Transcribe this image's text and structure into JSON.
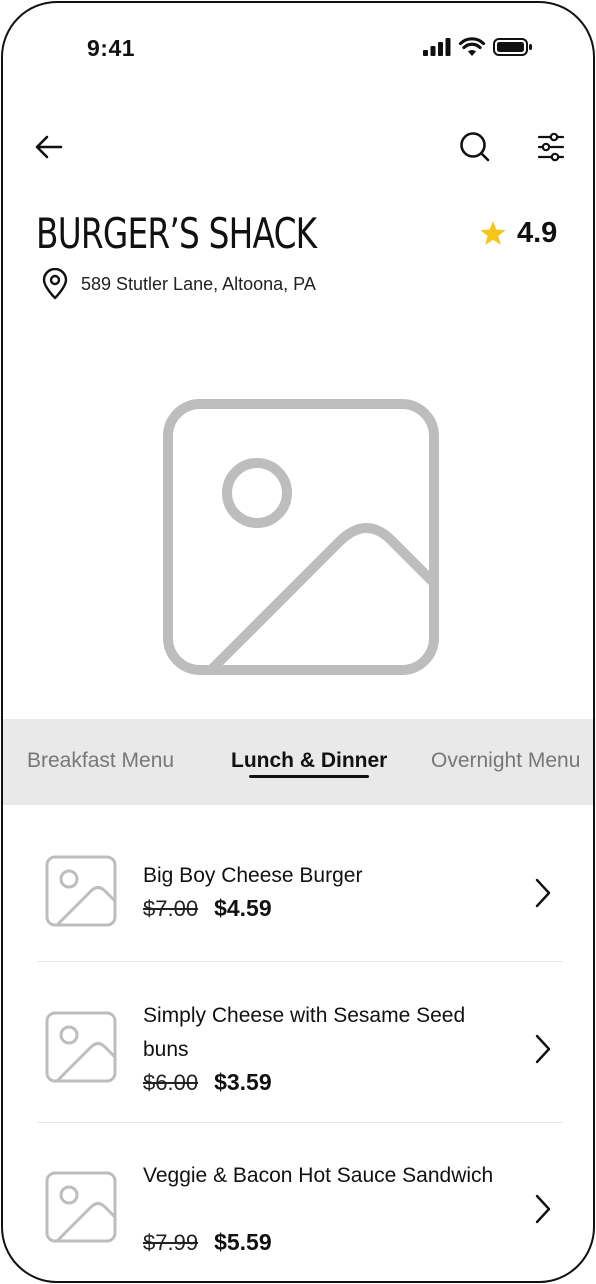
{
  "status_bar": {
    "time": "9:41"
  },
  "restaurant": {
    "name": "BURGER’S SHACK",
    "rating": "4.9",
    "address": "589 Stutler Lane, Altoona, PA"
  },
  "tabs": [
    {
      "label": "Breakfast Menu",
      "active": false
    },
    {
      "label": "Lunch & Dinner",
      "active": true
    },
    {
      "label": "Overnight Menu",
      "active": false
    }
  ],
  "menu_items": [
    {
      "name": "Big Boy Cheese Burger",
      "old_price": "$7.00",
      "new_price": "$4.59"
    },
    {
      "name": "Simply Cheese with Sesame Seed buns",
      "old_price": "$6.00",
      "new_price": "$3.59"
    },
    {
      "name": "Veggie & Bacon Hot Sauce Sandwich",
      "old_price": "$7.99",
      "new_price": "$5.59"
    }
  ],
  "icons": {
    "back": "arrow-left-icon",
    "search": "search-icon",
    "filter": "sliders-icon",
    "rating": "star-icon",
    "location": "map-pin-icon",
    "hero": "image-placeholder-icon",
    "chevron": "chevron-right-icon"
  },
  "colors": {
    "star": "#F5C518",
    "placeholder": "#BDBDBD",
    "tab_bar": "#E9E9E9"
  }
}
